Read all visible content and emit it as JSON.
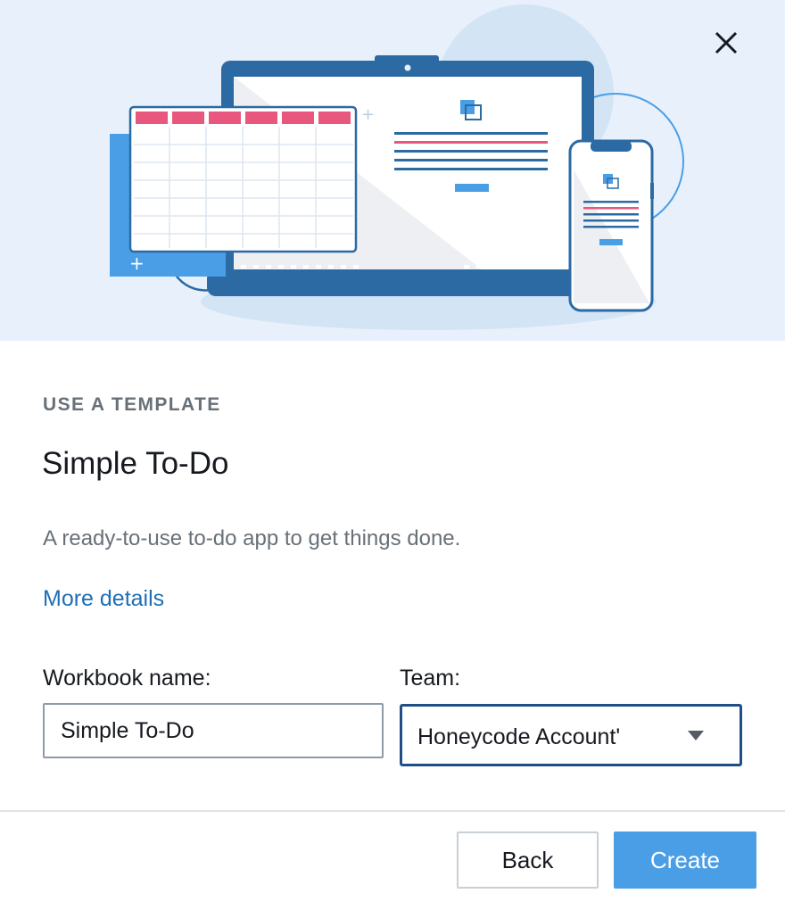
{
  "dialog": {
    "eyebrow": "USE A TEMPLATE",
    "title": "Simple To-Do",
    "description": "A ready-to-use to-do app to get things done.",
    "more_details_link": "More details"
  },
  "form": {
    "workbook_label": "Workbook name:",
    "workbook_value": "Simple To-Do",
    "team_label": "Team:",
    "team_value": "Honeycode Account'"
  },
  "footer": {
    "back_label": "Back",
    "create_label": "Create"
  },
  "icons": {
    "close": "close-icon",
    "dropdown": "caret-down-icon"
  },
  "colors": {
    "hero_bg": "#e8f1fb",
    "primary_button": "#4a9ee6",
    "link": "#1f6fb5",
    "illustration_navy": "#2c6aa3",
    "illustration_pink": "#e8577d"
  }
}
